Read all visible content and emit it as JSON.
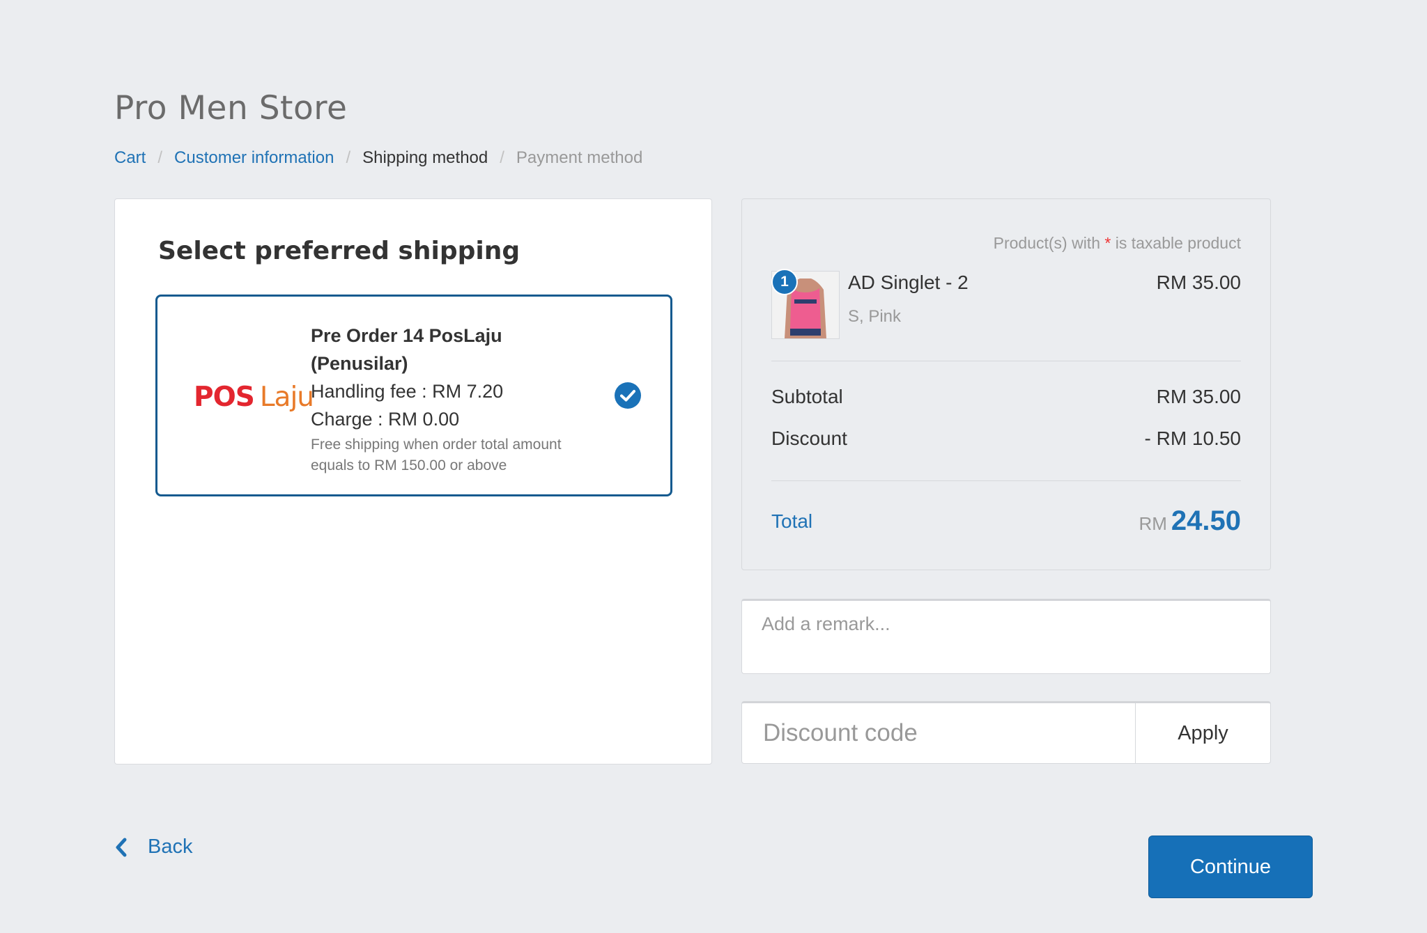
{
  "store": {
    "title": "Pro Men Store"
  },
  "breadcrumb": {
    "cart": "Cart",
    "customer_info": "Customer information",
    "shipping_method": "Shipping method",
    "payment_method": "Payment method",
    "separator": "/"
  },
  "shipping": {
    "heading": "Select preferred shipping",
    "option": {
      "logo_pos": "POS",
      "logo_laju": "Laju",
      "name_line1": "Pre Order 14 PosLaju",
      "name_line2": "(Penusilar)",
      "handling_fee": "Handling fee : RM 7.20",
      "charge": "Charge : RM 0.00",
      "note_line1": "Free shipping when order total amount",
      "note_line2": "equals to RM 150.00 or above",
      "selected": true
    }
  },
  "summary": {
    "tax_note_prefix": "Product(s) with",
    "tax_note_star": "*",
    "tax_note_suffix": "is taxable product",
    "product": {
      "quantity": "1",
      "name": "AD Singlet - 2",
      "variant": "S, Pink",
      "price": "RM 35.00"
    },
    "subtotal_label": "Subtotal",
    "subtotal_value": "RM 35.00",
    "discount_label": "Discount",
    "discount_value": "- RM 10.50",
    "total_label": "Total",
    "total_currency": "RM",
    "total_amount": "24.50"
  },
  "remark": {
    "placeholder": "Add a remark..."
  },
  "discount": {
    "placeholder": "Discount code",
    "apply_label": "Apply"
  },
  "nav": {
    "back_label": "Back",
    "continue_label": "Continue"
  },
  "colors": {
    "accent": "#1f72b5",
    "button": "#1670b8",
    "selected_border": "#145a8f",
    "pos_red": "#e3262f",
    "laju_orange": "#e87a29",
    "background": "#ebedf0"
  }
}
